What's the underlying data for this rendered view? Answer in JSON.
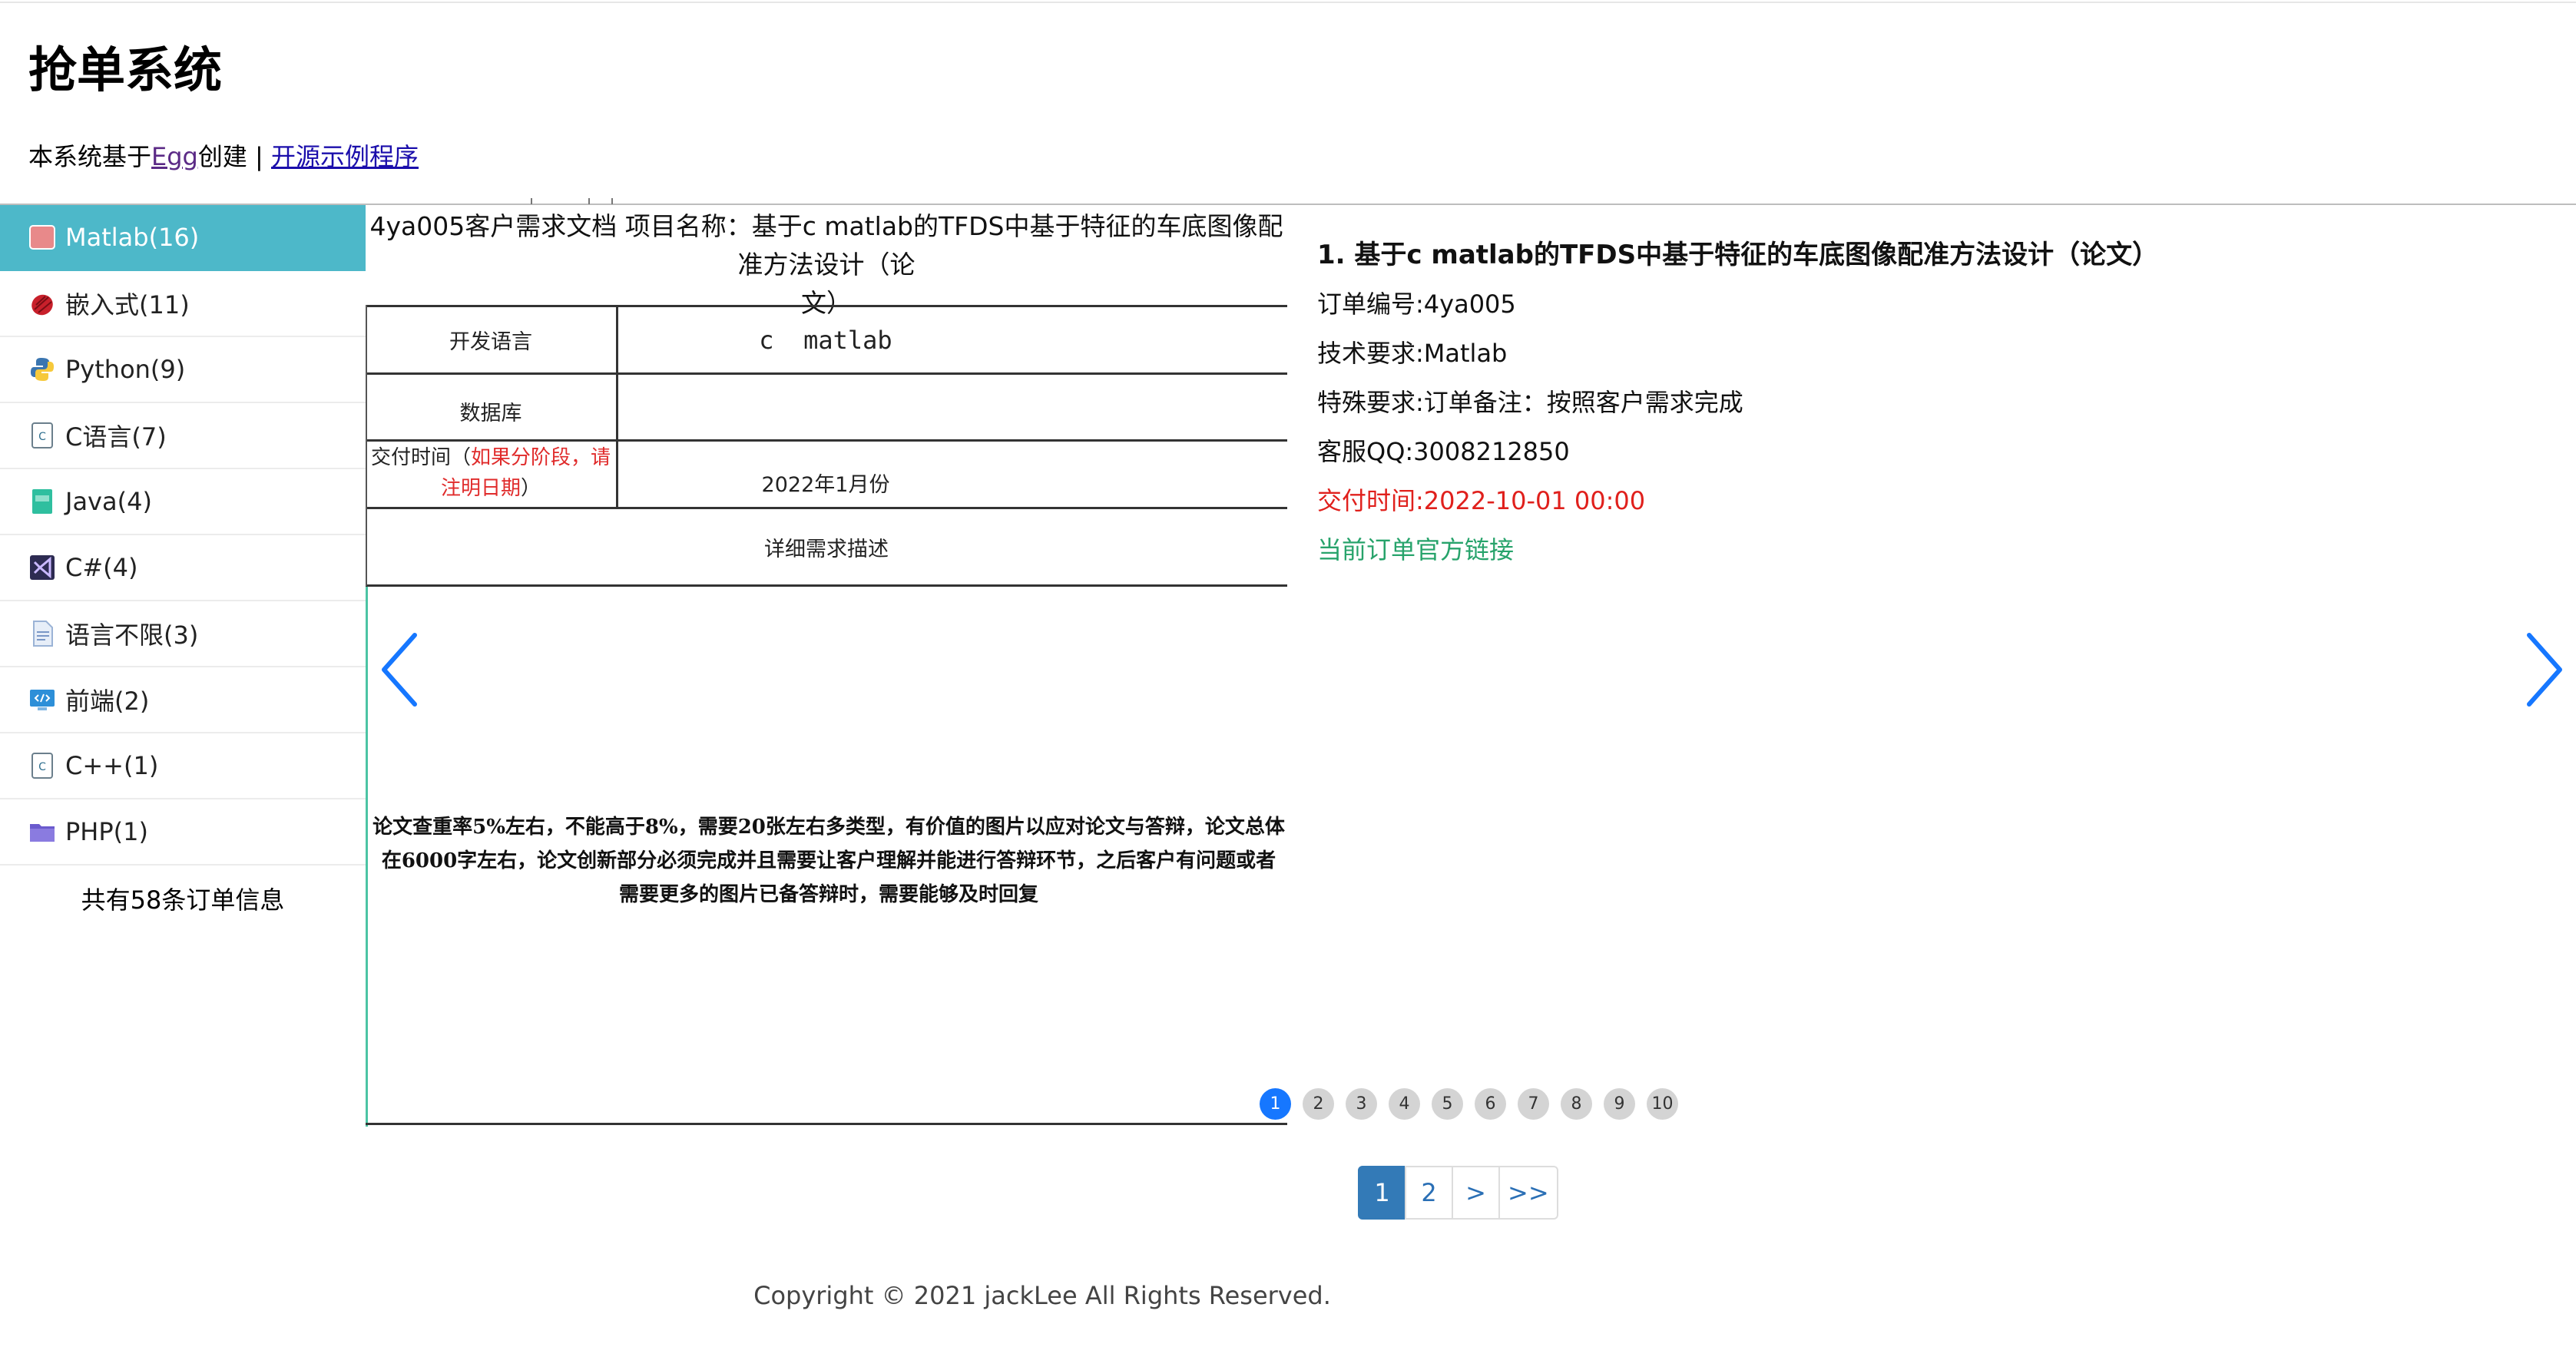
{
  "header": {
    "title": "抢单系统",
    "subtitle_prefix": "本系统基于",
    "egg_link": "Egg",
    "subtitle_middle": "创建 | ",
    "example_link": "开源示例程序"
  },
  "sidebar": {
    "items": [
      {
        "label": "Matlab(16)",
        "icon": "matlab-icon",
        "active": true
      },
      {
        "label": "嵌入式(11)",
        "icon": "embedded-icon"
      },
      {
        "label": "Python(9)",
        "icon": "python-icon"
      },
      {
        "label": "C语言(7)",
        "icon": "c-file-icon"
      },
      {
        "label": "Java(4)",
        "icon": "java-file-icon"
      },
      {
        "label": "C#(4)",
        "icon": "visual-studio-icon"
      },
      {
        "label": "语言不限(3)",
        "icon": "document-icon"
      },
      {
        "label": "前端(2)",
        "icon": "code-monitor-icon"
      },
      {
        "label": "C++(1)",
        "icon": "cpp-file-icon"
      },
      {
        "label": "PHP(1)",
        "icon": "php-folder-icon"
      }
    ],
    "total": "共有58条订单信息"
  },
  "doc": {
    "title_line1": "4ya005客户需求文档   项目名称：基于c matlab的TFDS中基于特征的车底图像配准方法设计（论",
    "title_line2": "文）",
    "lang_label": "开发语言",
    "lang_value": "c  matlab",
    "db_label": "数据库",
    "db_value": "",
    "delivery_label": "交付时间（",
    "delivery_note": "如果分阶段，请注明日期",
    "delivery_close": "）",
    "delivery_value": "2022年1月份",
    "detail_label": "详细需求描述",
    "body": "论文查重率5%左右，不能高于8%，需要20张左右多类型，有价值的图片以应对论文与答辩，论文总体在6000字左右，论文创新部分必须完成并且需要让客户理解并能进行答辩环节，之后客户有问题或者需要更多的图片已备答辩时，需要能够及时回复"
  },
  "detail": {
    "title": "1. 基于c matlab的TFDS中基于特征的车底图像配准方法设计（论文）",
    "order_no": "订单编号:4ya005",
    "tech": "技术要求:Matlab",
    "special": "特殊要求:订单备注：按照客户需求完成",
    "qq": "客服QQ:3008212850",
    "deadline": "交付时间:2022-10-01 00:00",
    "link": "当前订单官方链接",
    "deadline_color": "#e0201c",
    "link_color": "#27a36b"
  },
  "carousel": {
    "dots": [
      "1",
      "2",
      "3",
      "4",
      "5",
      "6",
      "7",
      "8",
      "9",
      "10"
    ],
    "active_dot": 0,
    "accent": "#1677ff"
  },
  "pagination": {
    "pages": [
      "1",
      "2",
      ">",
      ">>"
    ],
    "active": 0
  },
  "footer": "Copyright © 2021 jackLee All Rights Reserved."
}
